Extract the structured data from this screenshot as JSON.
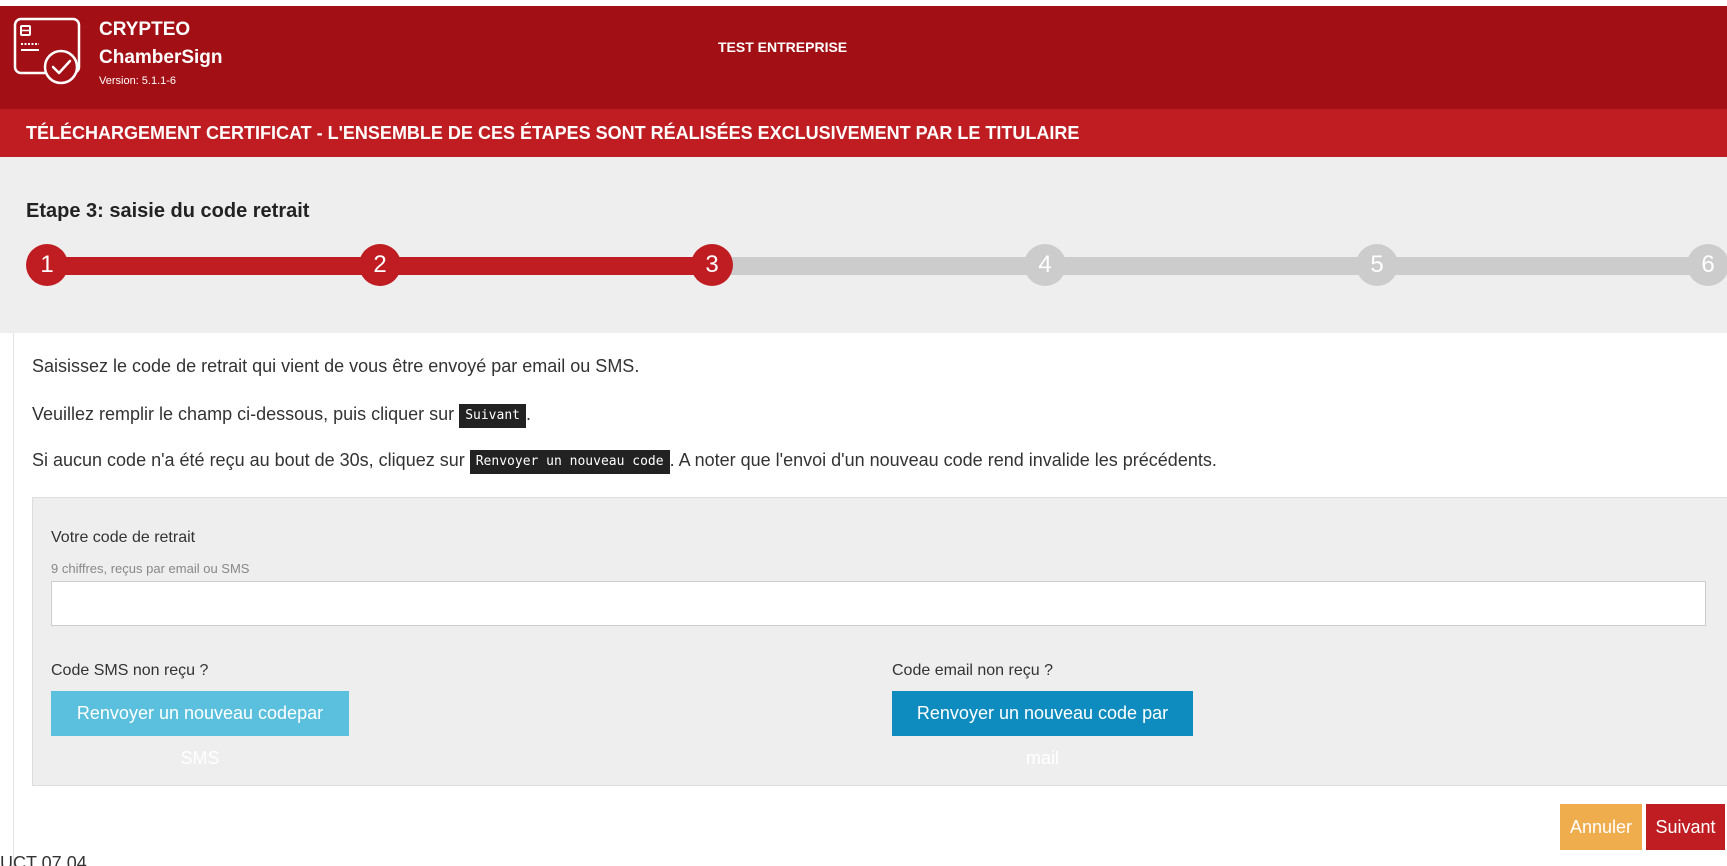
{
  "header": {
    "brand_line1": "CRYPTEO",
    "brand_line2": "ChamberSign",
    "version": "Version: 5.1.1-6",
    "company": "TEST ENTREPRISE",
    "logo_icon": "certificate-check-icon"
  },
  "title_bar": {
    "text": "TÉLÉCHARGEMENT CERTIFICAT - L'ENSEMBLE DE CES ÉTAPES SONT RÉALISÉES EXCLUSIVEMENT PAR LE TITULAIRE"
  },
  "stepper": {
    "heading": "Etape 3: saisie du code retrait",
    "current_step": 3,
    "steps": [
      "1",
      "2",
      "3",
      "4",
      "5",
      "6"
    ]
  },
  "instructions": {
    "line1": "Saisissez le code de retrait qui vient de vous être envoyé par email ou SMS.",
    "line2_before": "Veuillez remplir le champ ci-dessous, puis cliquer sur ",
    "line2_code": "Suivant",
    "line2_after": ".",
    "line3_before": "Si aucun code n'a été reçu au bout de 30s, cliquez sur ",
    "line3_code": "Renvoyer un nouveau code",
    "line3_after": ". A noter que l'envoi d'un nouveau code rend invalide les précédents."
  },
  "form": {
    "code_label": "Votre code de retrait",
    "code_help": "9 chiffres, reçus par email ou SMS",
    "code_value": "",
    "sms_label": "Code SMS non reçu ?",
    "sms_button": "Renvoyer un nouveau codepar SMS",
    "mail_label": "Code email non reçu ?",
    "mail_button": "Renvoyer un nouveau code par mail"
  },
  "actions": {
    "cancel": "Annuler",
    "next": "Suivant"
  },
  "footer_fragment": "UCT 07 04",
  "colors": {
    "header_dark_red": "#a20f14",
    "title_red": "#c01d22",
    "step_inactive": "#cccccc",
    "sms_button": "#5bc0de",
    "mail_button": "#0f8cbf",
    "cancel_button": "#f0ad4e",
    "next_button": "#c01d22"
  }
}
